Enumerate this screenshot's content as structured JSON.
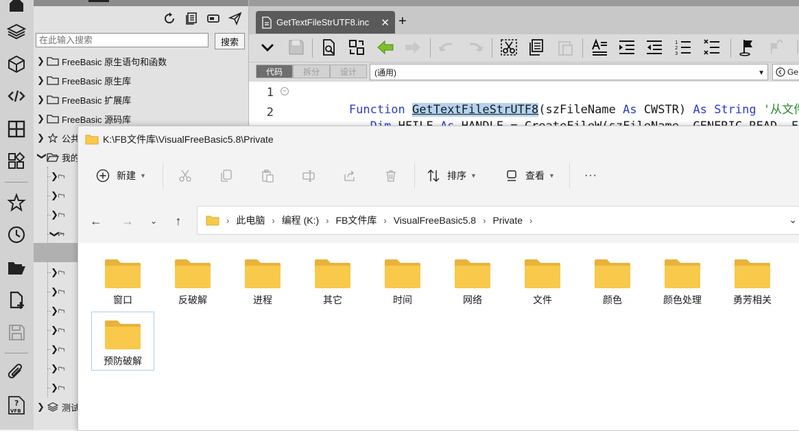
{
  "project_panel": {
    "search": {
      "placeholder": "在此输入搜索",
      "button_label": "搜索"
    },
    "tree": [
      {
        "label": "FreeBasic 原生语句和函数"
      },
      {
        "label": "FreeBasic 原生库"
      },
      {
        "label": "FreeBasic 扩展库"
      },
      {
        "label": "FreeBasic 源码库"
      },
      {
        "label": "公共"
      },
      {
        "label": "我的"
      },
      {
        "label": "测试"
      }
    ]
  },
  "editor": {
    "tab": {
      "title": "GetTextFileStrUTF8.inc",
      "close": "✕",
      "add": "+"
    },
    "modes": {
      "code": "代码",
      "split": "拆分",
      "design": "设计"
    },
    "scope_select": "(通用)",
    "proc_select": "Ge",
    "code": [
      {
        "line": "1",
        "parts": [
          {
            "t": "Function",
            "c": "kw"
          },
          {
            "t": " "
          },
          {
            "t": "GetTextFileStrUTF8",
            "c": "hl"
          },
          {
            "t": "(szFileName "
          },
          {
            "t": "As",
            "c": "kw"
          },
          {
            "t": " CWSTR) "
          },
          {
            "t": "As",
            "c": "kw"
          },
          {
            "t": " "
          },
          {
            "t": "String",
            "c": "kw"
          },
          {
            "t": " '从文件读",
            "c": "cm"
          }
        ]
      },
      {
        "line": "2",
        "parts": [
          {
            "t": "   "
          },
          {
            "t": "Dim",
            "c": "kw"
          },
          {
            "t": " HFILE "
          },
          {
            "t": "As",
            "c": "kw"
          },
          {
            "t": " HANDLE = CreateFileW(szFileName ,GENERIC_READ ,FILE_"
          }
        ]
      }
    ]
  },
  "explorer": {
    "title": "K:\\FB文件库\\VisualFreeBasic5.8\\Private",
    "commands": {
      "new": "新建",
      "sort": "排序",
      "view": "查看",
      "more": "···"
    },
    "breadcrumb": [
      "此电脑",
      "编程 (K:)",
      "FB文件库",
      "VisualFreeBasic5.8",
      "Private"
    ],
    "folders": [
      "窗口",
      "反破解",
      "进程",
      "其它",
      "时间",
      "网络",
      "文件",
      "颜色",
      "颜色处理",
      "勇芳相关",
      "预防破解"
    ],
    "colors": {
      "folder": "#f8c94b",
      "folder_tab": "#e9b23a",
      "accent": "#005fb8"
    }
  }
}
